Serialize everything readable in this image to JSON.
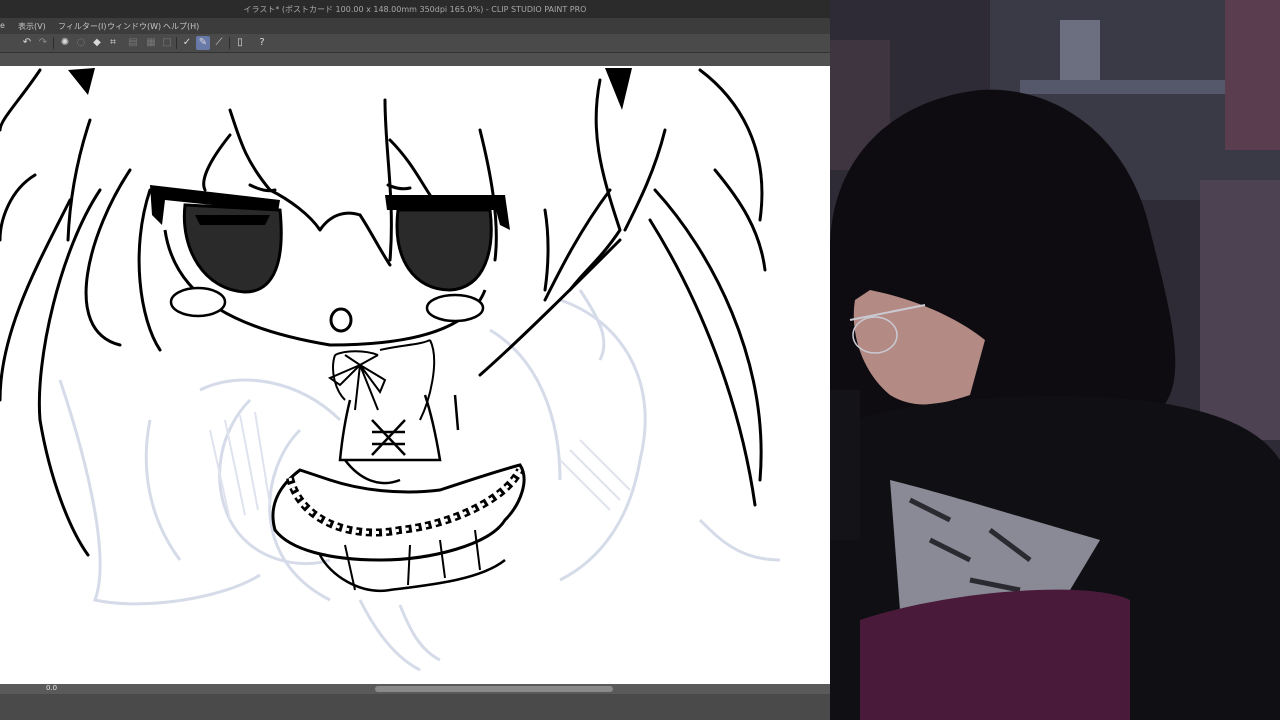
{
  "window": {
    "title": "イラスト* (ポストカード 100.00 x 148.00mm 350dpi 165.0%) - CLIP STUDIO PAINT PRO"
  },
  "menu": {
    "items": [
      {
        "label": "表示(V)"
      },
      {
        "label": "フィルター(I)"
      },
      {
        "label": "ウィンドウ(W)"
      },
      {
        "label": "ヘルプ(H)"
      }
    ]
  },
  "toolbar": {
    "buttons": [
      {
        "name": "undo-icon"
      },
      {
        "name": "redo-icon"
      },
      {
        "name": "clear-selection-icon"
      },
      {
        "name": "fill-icon"
      },
      {
        "name": "transform-icon"
      },
      {
        "name": "pen-check-icon"
      },
      {
        "name": "pen-active-icon"
      },
      {
        "name": "ruler-pen-icon"
      },
      {
        "name": "file-icon"
      },
      {
        "name": "help-icon"
      }
    ]
  },
  "status": {
    "zoom": "0.0"
  },
  "colors": {
    "accent": "#6a7aa8",
    "canvas": "#ffffff",
    "sketch": "#d5dbe8"
  }
}
